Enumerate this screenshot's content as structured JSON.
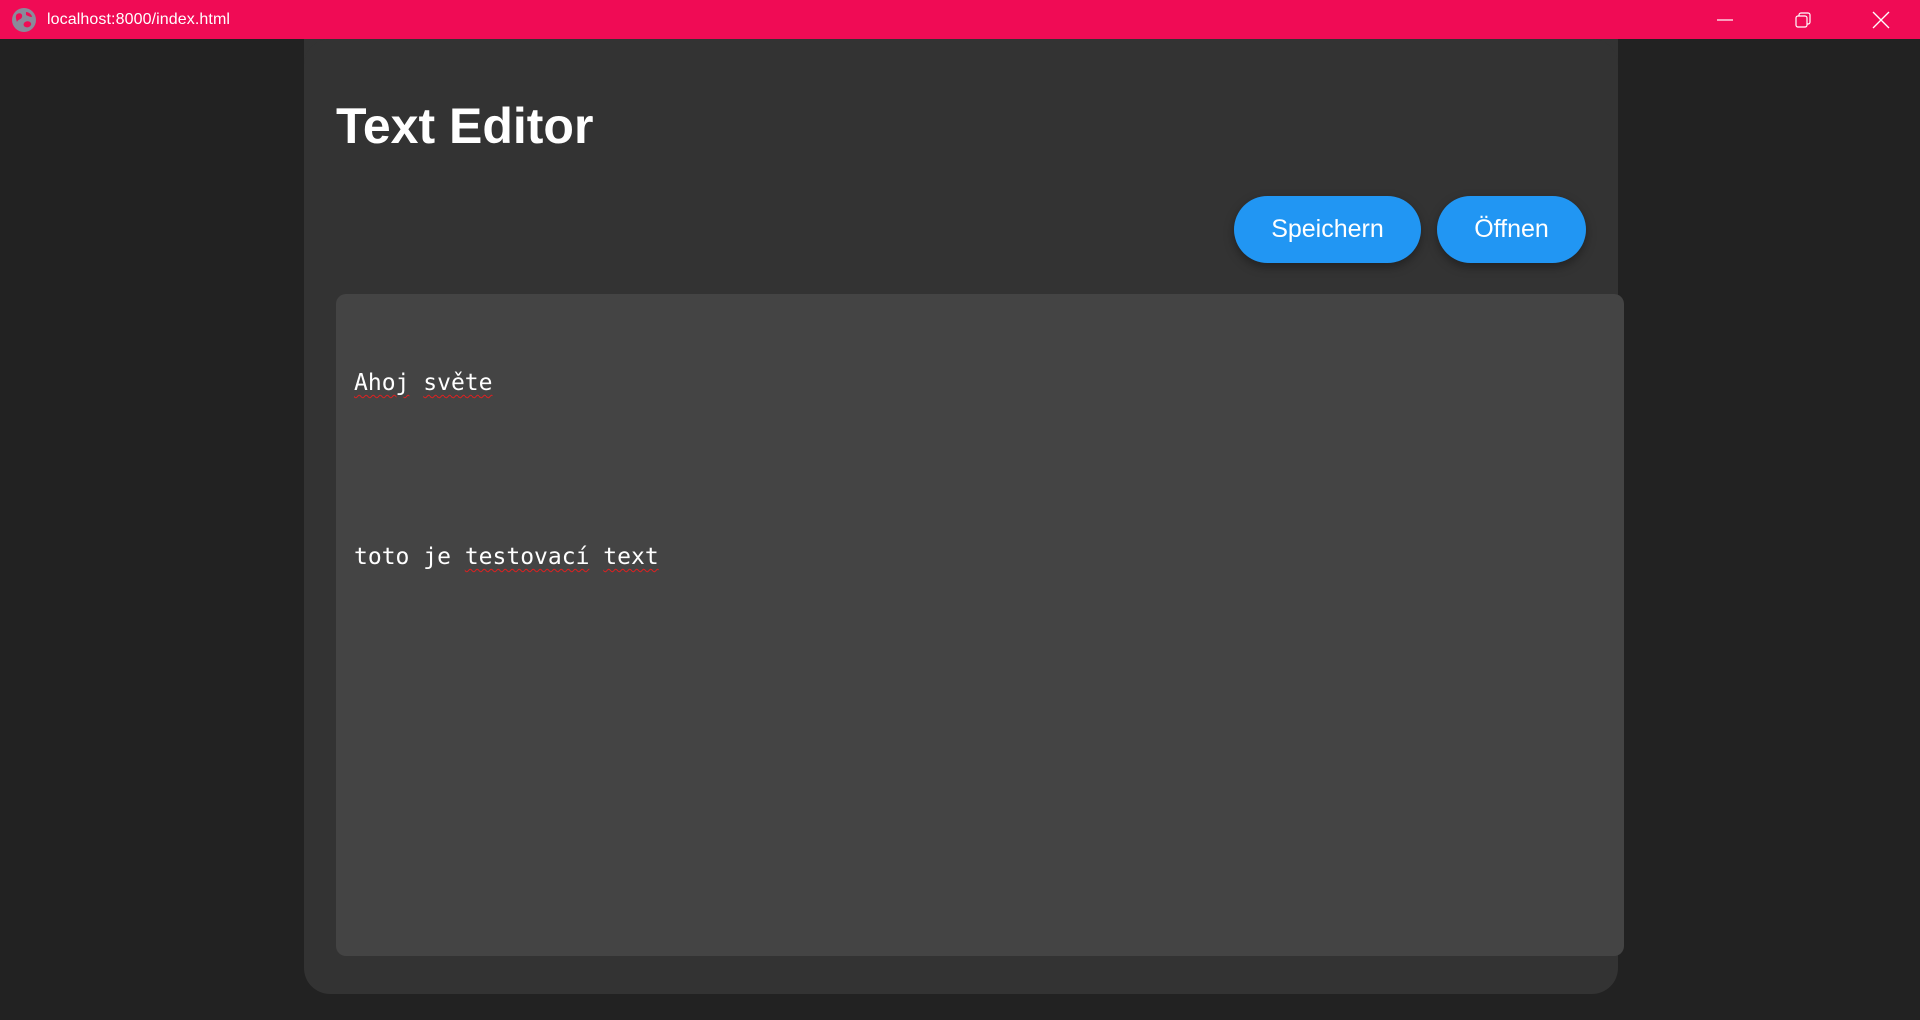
{
  "window": {
    "url": "localhost:8000/index.html",
    "accent_color": "#f00b55",
    "controls": {
      "minimize_icon": "minimize-icon",
      "restore_icon": "restore-icon",
      "close_icon": "close-icon"
    }
  },
  "page": {
    "title": "Text Editor",
    "background_color": "#222222",
    "card_color": "#333333"
  },
  "toolbar": {
    "save_label": "Speichern",
    "open_label": "Öffnen",
    "button_color": "#2196f3"
  },
  "editor": {
    "lines": [
      [
        "Ahoj",
        " ",
        "světe"
      ],
      [],
      [
        "toto",
        " ",
        "je",
        " ",
        "testovací",
        " ",
        "text"
      ]
    ],
    "line_text": {
      "l1_w1": "Ahoj",
      "l1_w2": "světe",
      "l3_w1": "toto",
      "l3_w2": "je",
      "l3_w3": "testovací",
      "l3_w4": "text"
    },
    "background_color": "#444444"
  }
}
